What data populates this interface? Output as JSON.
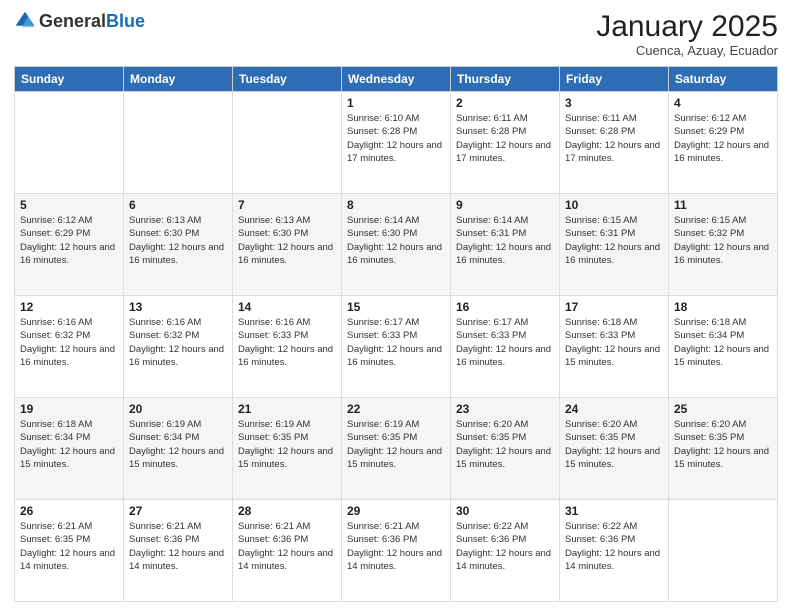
{
  "header": {
    "logo_general": "General",
    "logo_blue": "Blue",
    "month_title": "January 2025",
    "subtitle": "Cuenca, Azuay, Ecuador"
  },
  "days_of_week": [
    "Sunday",
    "Monday",
    "Tuesday",
    "Wednesday",
    "Thursday",
    "Friday",
    "Saturday"
  ],
  "weeks": [
    [
      {
        "day": "",
        "info": ""
      },
      {
        "day": "",
        "info": ""
      },
      {
        "day": "",
        "info": ""
      },
      {
        "day": "1",
        "info": "Sunrise: 6:10 AM\nSunset: 6:28 PM\nDaylight: 12 hours and 17 minutes."
      },
      {
        "day": "2",
        "info": "Sunrise: 6:11 AM\nSunset: 6:28 PM\nDaylight: 12 hours and 17 minutes."
      },
      {
        "day": "3",
        "info": "Sunrise: 6:11 AM\nSunset: 6:28 PM\nDaylight: 12 hours and 17 minutes."
      },
      {
        "day": "4",
        "info": "Sunrise: 6:12 AM\nSunset: 6:29 PM\nDaylight: 12 hours and 16 minutes."
      }
    ],
    [
      {
        "day": "5",
        "info": "Sunrise: 6:12 AM\nSunset: 6:29 PM\nDaylight: 12 hours and 16 minutes."
      },
      {
        "day": "6",
        "info": "Sunrise: 6:13 AM\nSunset: 6:30 PM\nDaylight: 12 hours and 16 minutes."
      },
      {
        "day": "7",
        "info": "Sunrise: 6:13 AM\nSunset: 6:30 PM\nDaylight: 12 hours and 16 minutes."
      },
      {
        "day": "8",
        "info": "Sunrise: 6:14 AM\nSunset: 6:30 PM\nDaylight: 12 hours and 16 minutes."
      },
      {
        "day": "9",
        "info": "Sunrise: 6:14 AM\nSunset: 6:31 PM\nDaylight: 12 hours and 16 minutes."
      },
      {
        "day": "10",
        "info": "Sunrise: 6:15 AM\nSunset: 6:31 PM\nDaylight: 12 hours and 16 minutes."
      },
      {
        "day": "11",
        "info": "Sunrise: 6:15 AM\nSunset: 6:32 PM\nDaylight: 12 hours and 16 minutes."
      }
    ],
    [
      {
        "day": "12",
        "info": "Sunrise: 6:16 AM\nSunset: 6:32 PM\nDaylight: 12 hours and 16 minutes."
      },
      {
        "day": "13",
        "info": "Sunrise: 6:16 AM\nSunset: 6:32 PM\nDaylight: 12 hours and 16 minutes."
      },
      {
        "day": "14",
        "info": "Sunrise: 6:16 AM\nSunset: 6:33 PM\nDaylight: 12 hours and 16 minutes."
      },
      {
        "day": "15",
        "info": "Sunrise: 6:17 AM\nSunset: 6:33 PM\nDaylight: 12 hours and 16 minutes."
      },
      {
        "day": "16",
        "info": "Sunrise: 6:17 AM\nSunset: 6:33 PM\nDaylight: 12 hours and 16 minutes."
      },
      {
        "day": "17",
        "info": "Sunrise: 6:18 AM\nSunset: 6:33 PM\nDaylight: 12 hours and 15 minutes."
      },
      {
        "day": "18",
        "info": "Sunrise: 6:18 AM\nSunset: 6:34 PM\nDaylight: 12 hours and 15 minutes."
      }
    ],
    [
      {
        "day": "19",
        "info": "Sunrise: 6:18 AM\nSunset: 6:34 PM\nDaylight: 12 hours and 15 minutes."
      },
      {
        "day": "20",
        "info": "Sunrise: 6:19 AM\nSunset: 6:34 PM\nDaylight: 12 hours and 15 minutes."
      },
      {
        "day": "21",
        "info": "Sunrise: 6:19 AM\nSunset: 6:35 PM\nDaylight: 12 hours and 15 minutes."
      },
      {
        "day": "22",
        "info": "Sunrise: 6:19 AM\nSunset: 6:35 PM\nDaylight: 12 hours and 15 minutes."
      },
      {
        "day": "23",
        "info": "Sunrise: 6:20 AM\nSunset: 6:35 PM\nDaylight: 12 hours and 15 minutes."
      },
      {
        "day": "24",
        "info": "Sunrise: 6:20 AM\nSunset: 6:35 PM\nDaylight: 12 hours and 15 minutes."
      },
      {
        "day": "25",
        "info": "Sunrise: 6:20 AM\nSunset: 6:35 PM\nDaylight: 12 hours and 15 minutes."
      }
    ],
    [
      {
        "day": "26",
        "info": "Sunrise: 6:21 AM\nSunset: 6:35 PM\nDaylight: 12 hours and 14 minutes."
      },
      {
        "day": "27",
        "info": "Sunrise: 6:21 AM\nSunset: 6:36 PM\nDaylight: 12 hours and 14 minutes."
      },
      {
        "day": "28",
        "info": "Sunrise: 6:21 AM\nSunset: 6:36 PM\nDaylight: 12 hours and 14 minutes."
      },
      {
        "day": "29",
        "info": "Sunrise: 6:21 AM\nSunset: 6:36 PM\nDaylight: 12 hours and 14 minutes."
      },
      {
        "day": "30",
        "info": "Sunrise: 6:22 AM\nSunset: 6:36 PM\nDaylight: 12 hours and 14 minutes."
      },
      {
        "day": "31",
        "info": "Sunrise: 6:22 AM\nSunset: 6:36 PM\nDaylight: 12 hours and 14 minutes."
      },
      {
        "day": "",
        "info": ""
      }
    ]
  ]
}
